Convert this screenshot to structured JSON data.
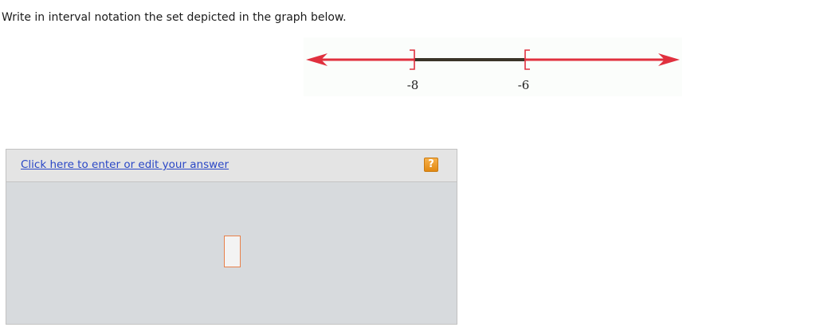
{
  "question": {
    "text": "Write in interval notation the set depicted in the graph below."
  },
  "number_line": {
    "left_endpoint": {
      "value": -8,
      "label": "-8",
      "bracket": "]"
    },
    "right_endpoint": {
      "value": -6,
      "label": "-6",
      "bracket": "["
    },
    "shaded": "outside both endpoints (x ≤ -8 or x ≥ -6), extending to infinity in both directions",
    "colors": {
      "shaded_line": "#e0303e",
      "unshaded_segment": "#3a3428",
      "background": "#fbfdfb"
    }
  },
  "answer_panel": {
    "link_text": "Click here to enter or edit your answer",
    "help_label": "?",
    "answer_value": "",
    "colors": {
      "link": "#2a47c6",
      "help_button": "#f0a030",
      "input_border": "#e8804a"
    }
  }
}
